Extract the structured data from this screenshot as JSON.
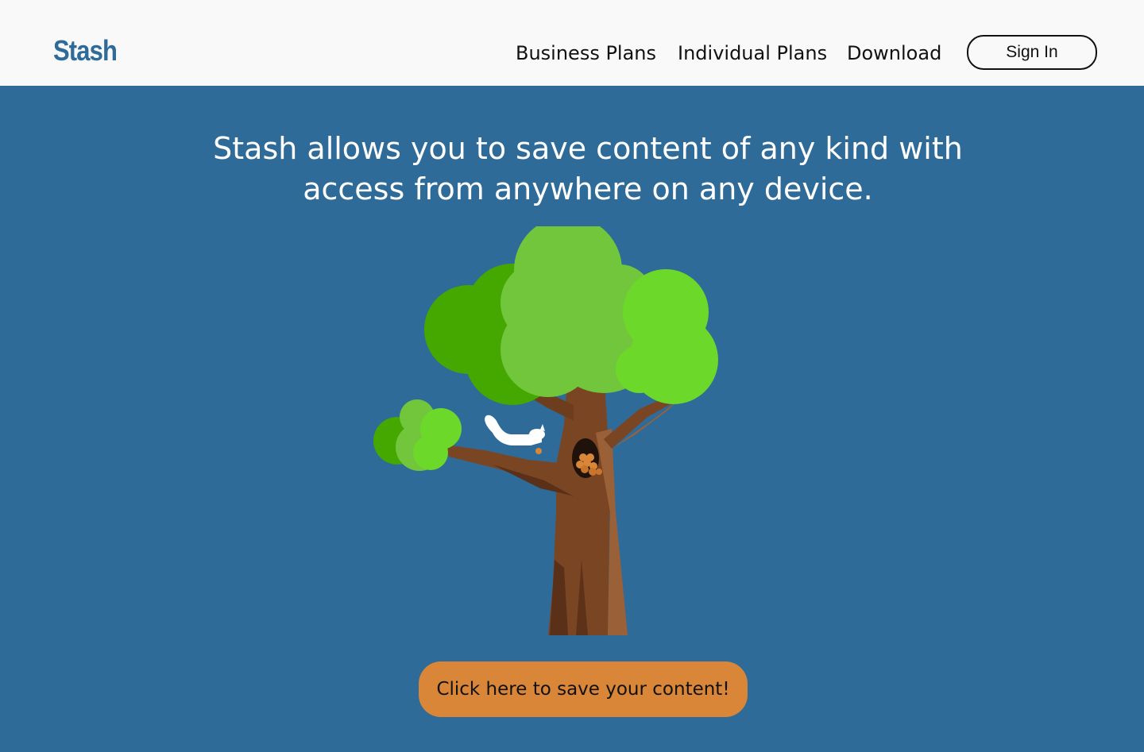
{
  "header": {
    "logo": "Stash",
    "nav": [
      {
        "label": "Business Plans"
      },
      {
        "label": "Individual Plans"
      },
      {
        "label": "Download"
      }
    ],
    "signin_label": "Sign In"
  },
  "hero": {
    "headline": "Stash allows you to save content of any kind with access from anywhere on any device.",
    "cta_label": "Click here to save your content!"
  },
  "colors": {
    "header_bg": "#f9f9f9",
    "page_bg": "#2f6b99",
    "brand": "#2f6b99",
    "cta_bg": "#d98638",
    "trunk": "#7a4522",
    "leaf_dark": "#44a800",
    "leaf_mid": "#72c63c",
    "leaf_bright": "#6cd82a"
  },
  "illustration": {
    "icons": [
      "tree-icon",
      "squirrel-icon",
      "acorn-stash-icon"
    ]
  }
}
